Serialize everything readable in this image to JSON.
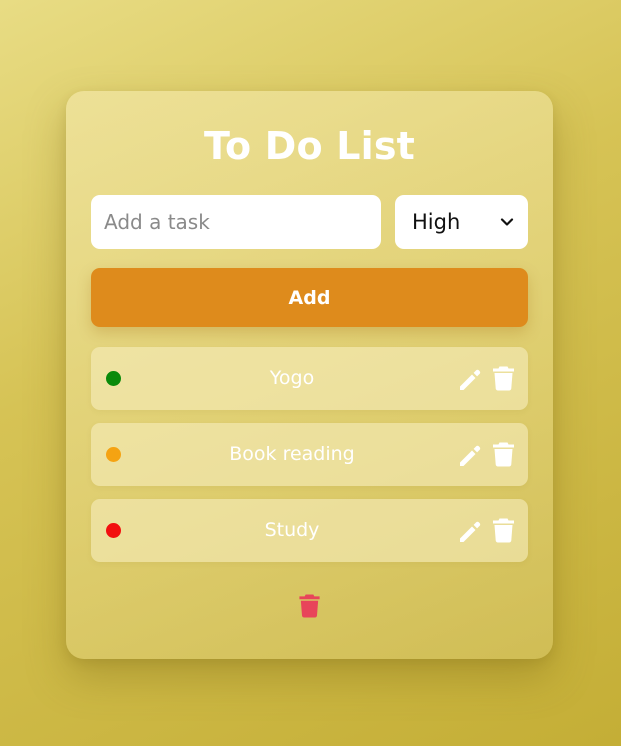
{
  "app": {
    "title": "To Do List"
  },
  "form": {
    "task_value": "",
    "task_placeholder": "Add a task",
    "priority_selected": "High",
    "add_label": "Add"
  },
  "tasks": [
    {
      "text": "Yogo",
      "priority_color": "#0a8a0a"
    },
    {
      "text": "Book reading",
      "priority_color": "#f5a312"
    },
    {
      "text": "Study",
      "priority_color": "#f20f0f"
    }
  ],
  "colors": {
    "accent": "#de8b1c",
    "clear_all": "#e8455a"
  },
  "icons": {
    "edit": "pencil-icon",
    "delete": "trash-icon",
    "clear_all": "trash-icon",
    "select": "chevron-down-icon"
  }
}
